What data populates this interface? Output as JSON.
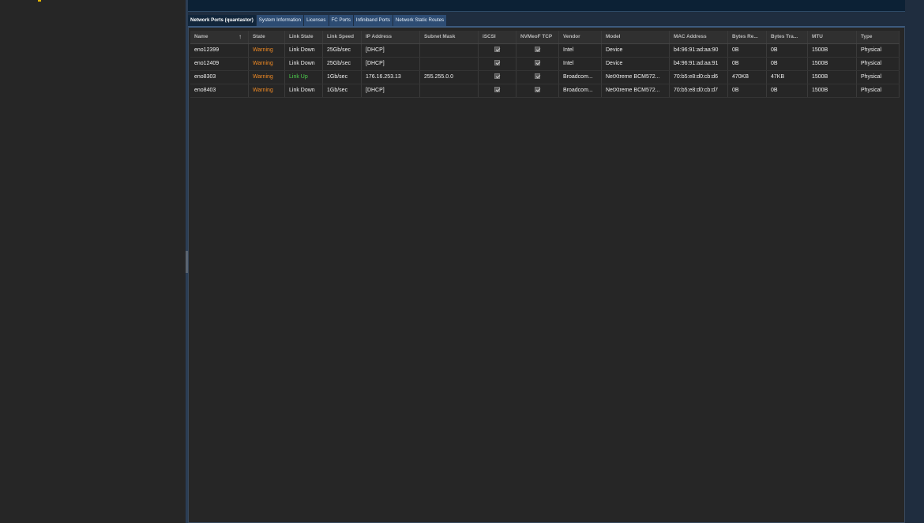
{
  "tabs": [
    {
      "label": "Network Ports (quantastor)",
      "active": true
    },
    {
      "label": "System Information",
      "active": false
    },
    {
      "label": "Licenses",
      "active": false
    },
    {
      "label": "FC Ports",
      "active": false
    },
    {
      "label": "Infiniband Ports",
      "active": false
    },
    {
      "label": "Network Static Routes",
      "active": false
    }
  ],
  "grid": {
    "sort_icon": "↑",
    "columns": [
      "Name",
      "State",
      "Link State",
      "Link Speed",
      "IP Address",
      "Subnet Mask",
      "iSCSI",
      "NVMeoF TCP",
      "Vendor",
      "Model",
      "MAC Address",
      "Bytes Re...",
      "Bytes Tra...",
      "MTU",
      "Type"
    ],
    "rows": [
      [
        "eno12399",
        "Warning",
        "Link Down",
        "25Gb/sec",
        "[DHCP]",
        "",
        "checked",
        "checked",
        "Intel",
        "Device",
        "b4:96:91:ad:aa:90",
        "0B",
        "0B",
        "1500B",
        "Physical"
      ],
      [
        "eno12409",
        "Warning",
        "Link Down",
        "25Gb/sec",
        "[DHCP]",
        "",
        "checked",
        "checked",
        "Intel",
        "Device",
        "b4:96:91:ad:aa:91",
        "0B",
        "0B",
        "1500B",
        "Physical"
      ],
      [
        "eno8303",
        "Warning",
        "Link Up",
        "1Gb/sec",
        "176.16.253.13",
        "255.255.0.0",
        "checked",
        "checked",
        "Broadcom...",
        "NetXtreme BCM572...",
        "70:b5:e8:d0:cb:d6",
        "470KB",
        "47KB",
        "1500B",
        "Physical"
      ],
      [
        "eno8403",
        "Warning",
        "Link Down",
        "1Gb/sec",
        "[DHCP]",
        "",
        "checked",
        "checked",
        "Broadcom...",
        "NetXtreme BCM572...",
        "70:b5:e8:d0:cb:d7",
        "0B",
        "0B",
        "1500B",
        "Physical"
      ]
    ]
  },
  "colors": {
    "warning": "#f08a24",
    "link_up": "#4ed04e",
    "active_tab": "#12263b",
    "tab": "#2d4c73"
  }
}
